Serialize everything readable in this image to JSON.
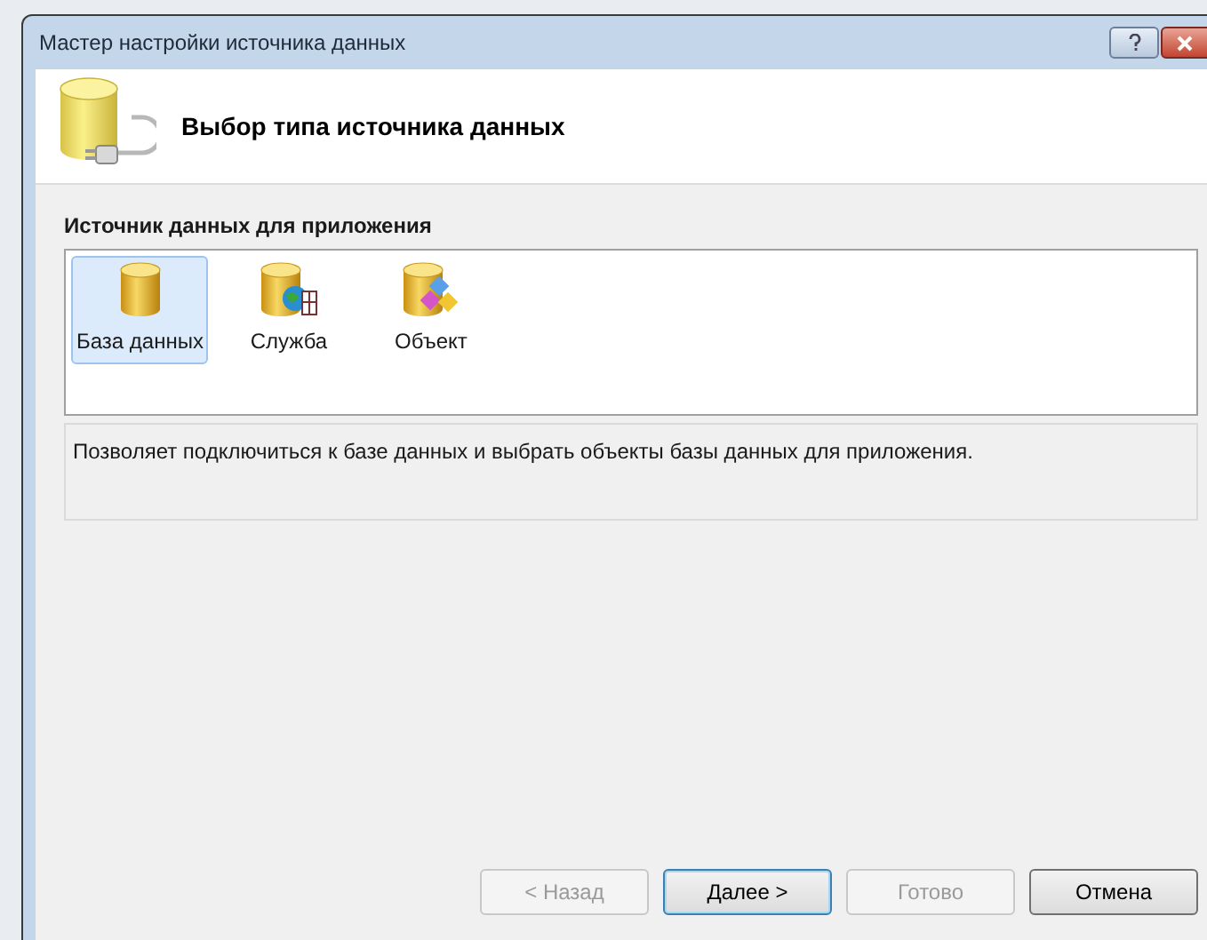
{
  "window": {
    "title": "Мастер настройки источника данных"
  },
  "header": {
    "title": "Выбор типа источника данных"
  },
  "source_list": {
    "label": "Источник данных для приложения",
    "items": [
      {
        "kind": "database",
        "label": "База данных",
        "selected": true
      },
      {
        "kind": "service",
        "label": "Служба",
        "selected": false
      },
      {
        "kind": "object",
        "label": "Объект",
        "selected": false
      }
    ]
  },
  "description": "Позволяет подключиться к базе данных и выбрать объекты базы данных для приложения.",
  "buttons": [
    {
      "label": "< Назад",
      "disabled": true,
      "default": false
    },
    {
      "label": "Далее >",
      "disabled": false,
      "default": true
    },
    {
      "label": "Готово",
      "disabled": true,
      "default": false
    },
    {
      "label": "Отмена",
      "disabled": false,
      "default": false
    }
  ]
}
